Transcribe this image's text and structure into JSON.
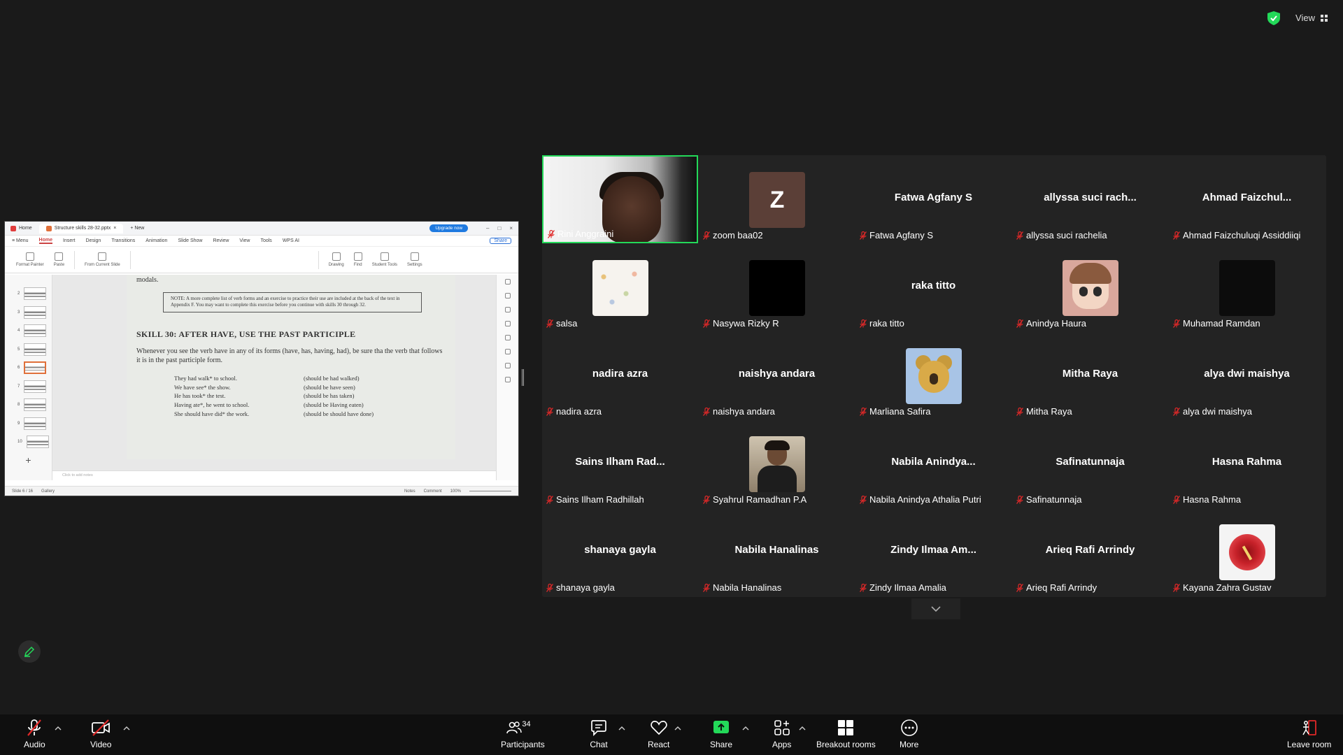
{
  "top_right": {
    "view_label": "View"
  },
  "shared_window": {
    "tabs": [
      {
        "label": "Home"
      },
      {
        "label": "Structure skills 28-32.pptx"
      },
      {
        "label": "+ New"
      }
    ],
    "upgrade_label": "Upgrade now",
    "menu": [
      "≡ Menu",
      "Home",
      "Insert",
      "Design",
      "Transitions",
      "Animation",
      "Slide Show",
      "Review",
      "View",
      "Tools",
      "WPS AI"
    ],
    "share_label": "Share",
    "ribbon": [
      "Format Painter",
      "Paste",
      "From Current Slide",
      "Drawing",
      "Find",
      "Student Tools",
      "Settings"
    ],
    "thumbnails": [
      "2",
      "3",
      "4",
      "5",
      "6",
      "7",
      "8",
      "9",
      "10"
    ],
    "slide": {
      "top_fragment": "modals.",
      "note": "NOTE: A more complete list of verb forms and an exercise to practice their use are included at the back of the text in Appendix F. You may want to complete this exercise before you continue with skills 30 through 32.",
      "skill_title": "SKILL 30:  AFTER HAVE, USE THE PAST PARTICIPLE",
      "paragraph": "Whenever you see the verb have in any of its forms (have, has, having, had), be sure tha the verb that follows it is in the past participle form.",
      "examples": [
        {
          "wrong": "They had walk* to school.",
          "right": "(should be had walked)"
        },
        {
          "wrong": "We have see* the show.",
          "right": "(should be have seen)"
        },
        {
          "wrong": "He has took* the test.",
          "right": "(should be has taken)"
        },
        {
          "wrong": "Having ate*, he went to school.",
          "right": "(should be Having eaten)"
        },
        {
          "wrong": "She should have did* the work.",
          "right": "(should be should have done)"
        }
      ]
    },
    "notes_placeholder": "Click to add notes",
    "status": {
      "slide": "Slide 6 / 16",
      "gallery": "Gallery",
      "notes": "Notes",
      "comment": "Comment",
      "zoom": "100%"
    }
  },
  "participants": [
    {
      "name": "Rini Anggraini",
      "type": "video"
    },
    {
      "name": "zoom baa02",
      "type": "letter",
      "letter": "Z"
    },
    {
      "name": "Fatwa Agfany S",
      "display": "Fatwa Agfany S",
      "type": "text"
    },
    {
      "name": "allyssa suci rachelia",
      "display": "allyssa  suci  rach...",
      "type": "text"
    },
    {
      "name": "Ahmad Faizchuluqi Assiddiiqi",
      "display": "Ahmad  Faizchul...",
      "type": "text"
    },
    {
      "name": "salsa",
      "type": "pattern"
    },
    {
      "name": "Nasywa Rizky R",
      "type": "black"
    },
    {
      "name": "raka titto",
      "display": "raka titto",
      "type": "text"
    },
    {
      "name": "Anindya Haura",
      "type": "anime"
    },
    {
      "name": "Muhamad Ramdan",
      "type": "dark"
    },
    {
      "name": "nadira azra",
      "display": "nadira azra",
      "type": "text"
    },
    {
      "name": "naishya andara",
      "display": "naishya andara",
      "type": "text"
    },
    {
      "name": "Marliana Safira",
      "type": "koala"
    },
    {
      "name": "Mitha Raya",
      "display": "Mitha Raya",
      "type": "text"
    },
    {
      "name": "alya dwi maishya",
      "display": "alya dwi maishya",
      "type": "text"
    },
    {
      "name": "Sains Ilham Radhillah",
      "display": "Sains  Ilham  Rad...",
      "type": "text"
    },
    {
      "name": "Syahrul Ramadhan P.A",
      "type": "photo"
    },
    {
      "name": "Nabila Anindya Athalia Putri",
      "display": "Nabila  Anindya...",
      "type": "text"
    },
    {
      "name": "Safinatunnaja",
      "display": "Safinatunnaja",
      "type": "text"
    },
    {
      "name": "Hasna Rahma",
      "display": "Hasna Rahma",
      "type": "text"
    },
    {
      "name": "shanaya gayla",
      "display": "shanaya gayla",
      "type": "text"
    },
    {
      "name": "Nabila Hanalinas",
      "display": "Nabila Hanalinas",
      "type": "text"
    },
    {
      "name": "Zindy Ilmaa Amalia",
      "display": "Zindy  Ilmaa  Am...",
      "type": "text"
    },
    {
      "name": "Arieq Rafi Arrindy",
      "display": "Arieq Rafi Arrindy",
      "type": "text"
    },
    {
      "name": "Kayana Zahra Gustav",
      "type": "flower"
    }
  ],
  "toolbar": {
    "audio": "Audio",
    "video": "Video",
    "participants": "Participants",
    "participants_count": "34",
    "chat": "Chat",
    "react": "React",
    "share": "Share",
    "apps": "Apps",
    "breakout": "Breakout rooms",
    "more": "More",
    "leave": "Leave room"
  },
  "colors": {
    "accent_green": "#23d959",
    "mute_red": "#e02828",
    "share_green": "#23d959"
  }
}
